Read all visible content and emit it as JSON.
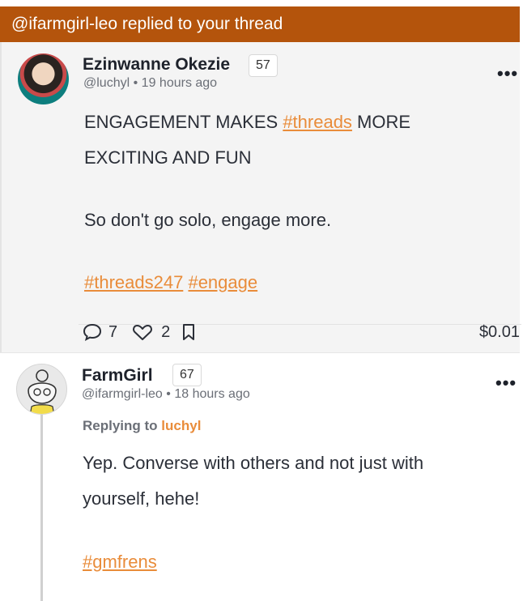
{
  "notification": {
    "text": "@ifarmgirl-leo replied to your thread"
  },
  "post": {
    "author_name": "Ezinwanne Okezie",
    "reputation": "57",
    "handle": "@luchyl",
    "time": "19 hours ago",
    "line1_before": "ENGAGEMENT MAKES ",
    "line1_tag": "#threads",
    "line1_after": " MORE",
    "line2": "EXCITING AND FUN",
    "para2": "So don't go solo, engage more.",
    "tag1": "#threads247",
    "tag2": "#engage",
    "comments_count": "7",
    "likes_count": "2",
    "payout": "$0.01",
    "menu_glyph": "•••"
  },
  "reply": {
    "author_name": "FarmGirl",
    "reputation": "67",
    "handle": "@ifarmgirl-leo",
    "time": "18 hours ago",
    "replying_label": "Replying to",
    "replying_user": "luchyl",
    "line1": "Yep. Converse with others and not just with",
    "line2": "yourself, hehe!",
    "tag": "#gmfrens",
    "menu_glyph": "•••"
  },
  "meta_separator": "•",
  "colors": {
    "banner": "#b4540c",
    "link": "#e98c3a",
    "card_bg": "#f4f4f4"
  }
}
